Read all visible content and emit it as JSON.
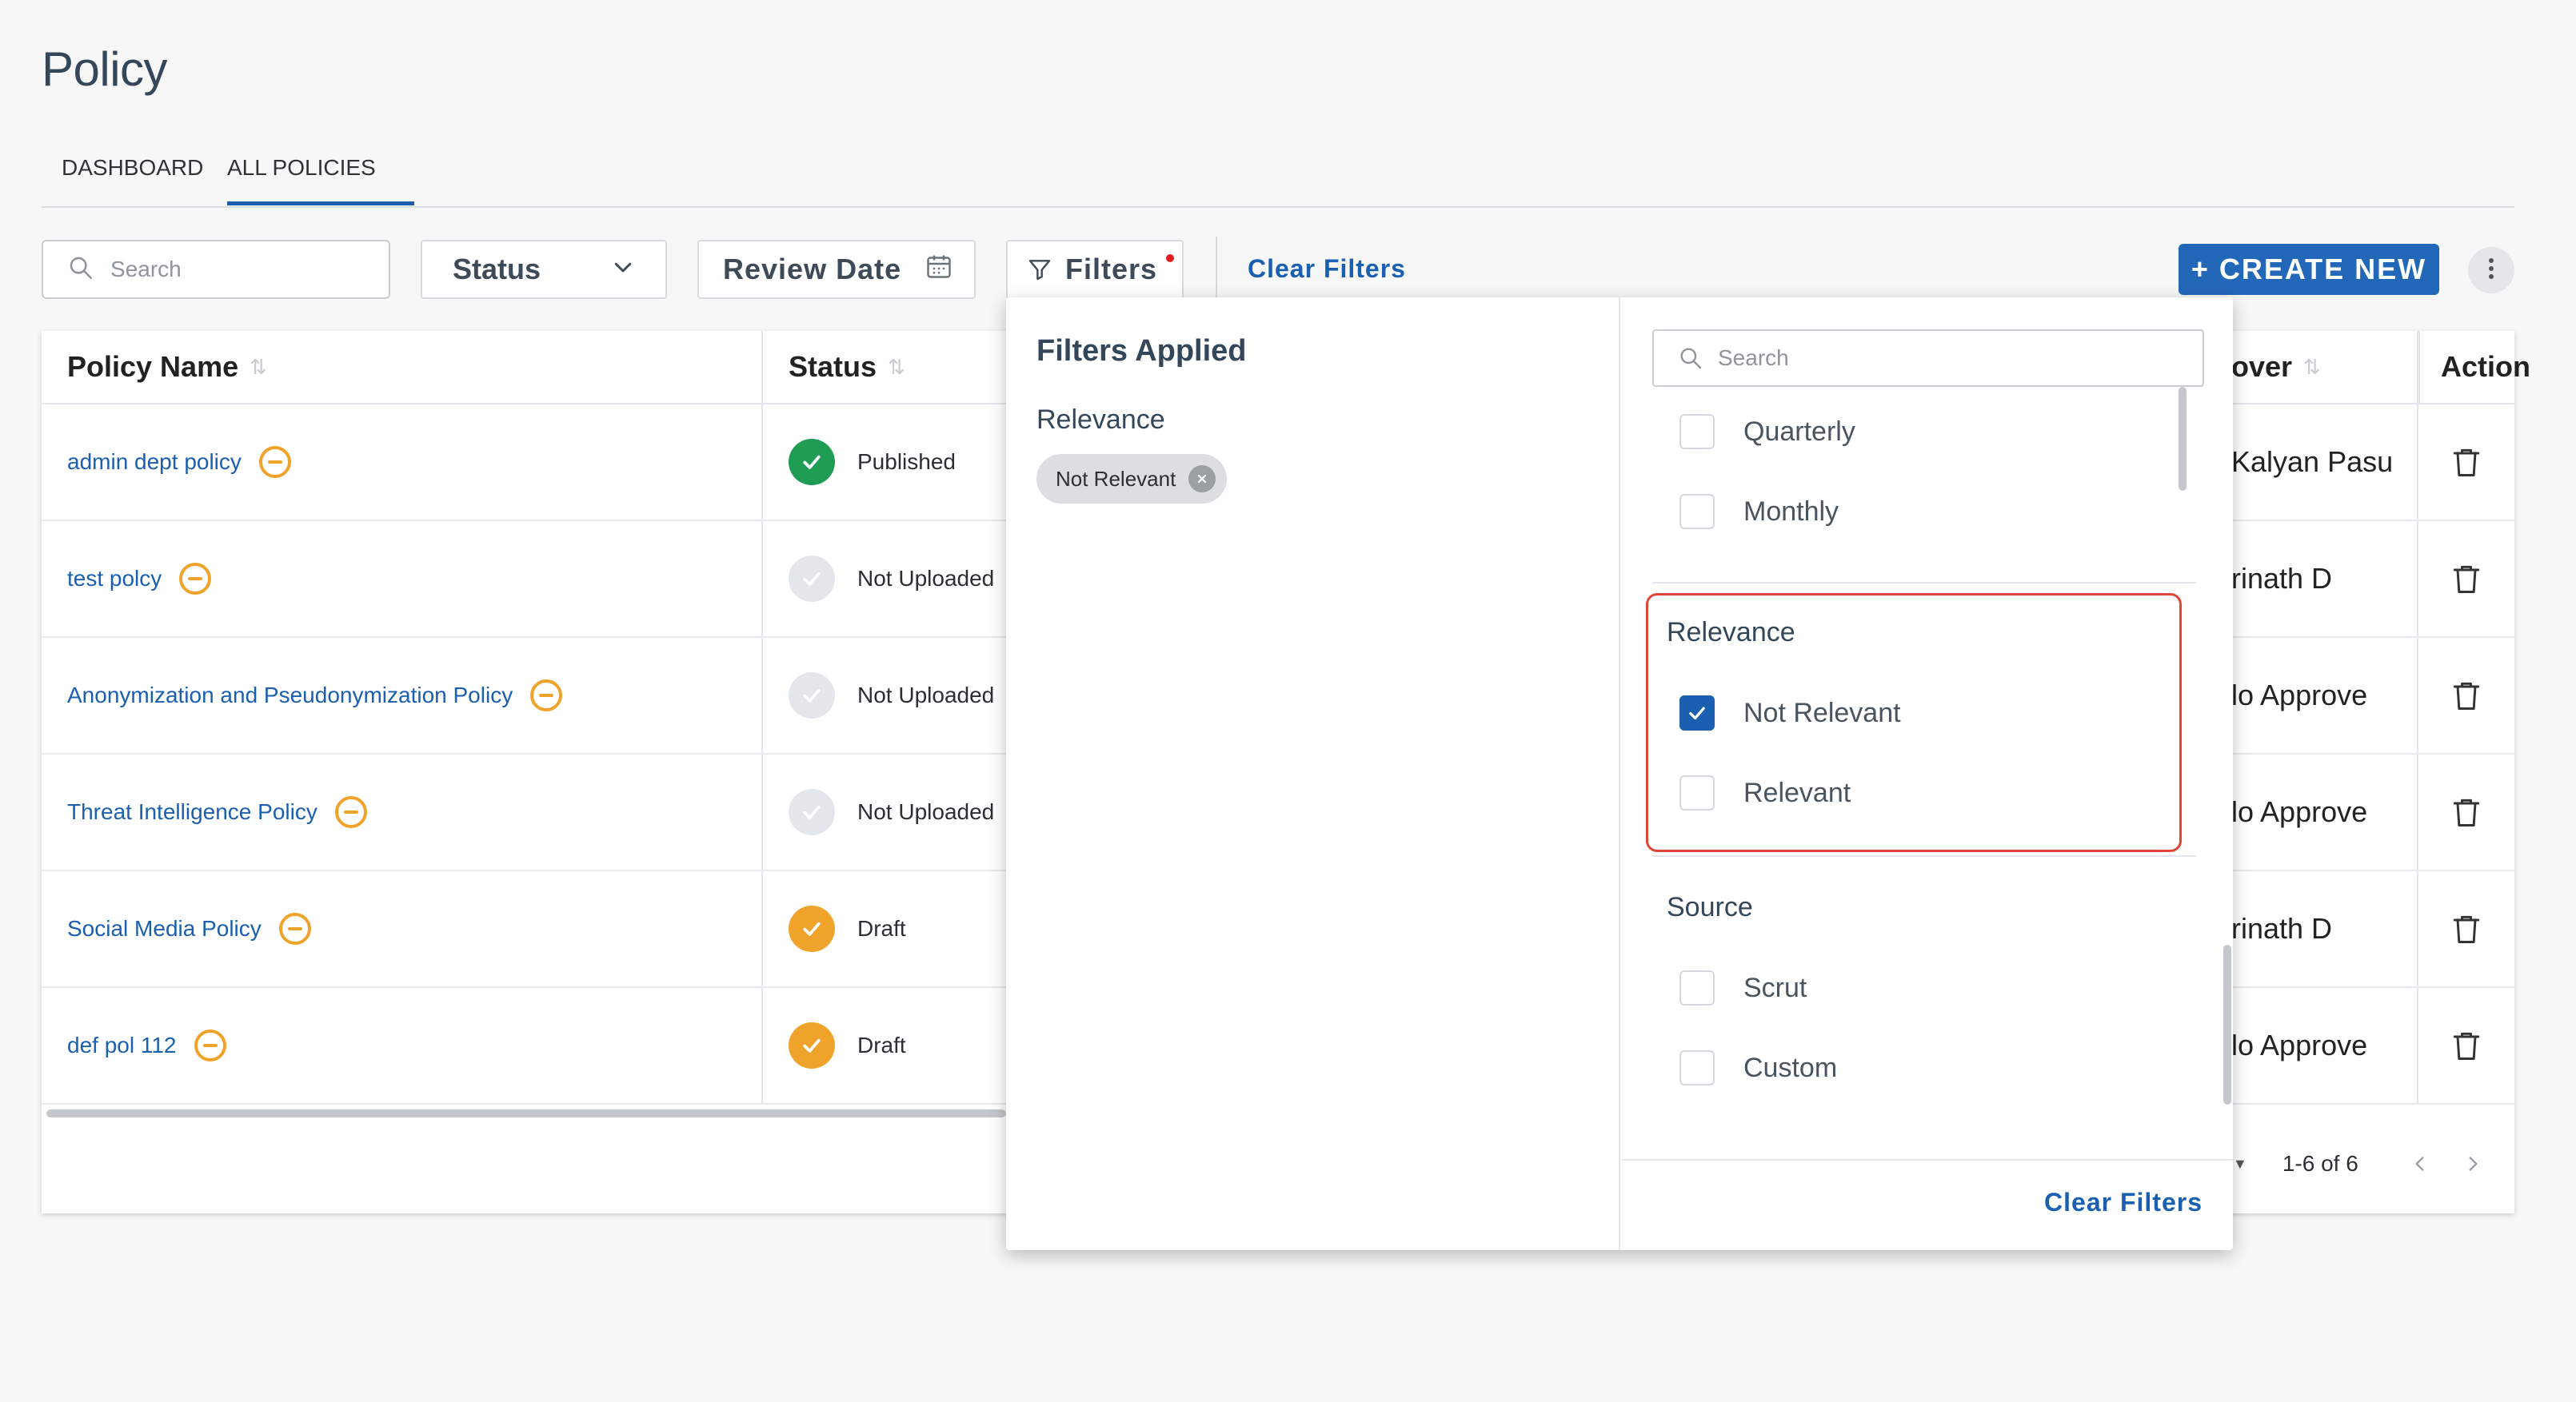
{
  "page": {
    "title": "Policy"
  },
  "tabs": [
    {
      "label": "DASHBOARD"
    },
    {
      "label": "ALL POLICIES",
      "active": true
    }
  ],
  "toolbar": {
    "search_placeholder": "Search",
    "status_label": "Status",
    "review_date_label": "Review Date",
    "filters_label": "Filters",
    "clear_filters_label": "Clear Filters",
    "create_new_label": "+ CREATE NEW"
  },
  "table": {
    "columns": {
      "policy_name": "Policy Name",
      "status": "Status",
      "approver": "over",
      "action": "Action"
    },
    "rows": [
      {
        "name": "admin dept policy",
        "status": "Published",
        "approver": "Kalyan Pasu"
      },
      {
        "name": "test polcy",
        "status": "Not Uploaded",
        "approver": "rinath D"
      },
      {
        "name": "Anonymization and Pseudonymization Policy",
        "status": "Not Uploaded",
        "approver": "lo Approve"
      },
      {
        "name": "Threat Intelligence Policy",
        "status": "Not Uploaded",
        "approver": "lo Approve"
      },
      {
        "name": "Social Media Policy",
        "status": "Draft",
        "approver": "rinath D"
      },
      {
        "name": "def pol 112",
        "status": "Draft",
        "approver": "lo Approve"
      }
    ],
    "pagination": {
      "range": "1-6 of 6"
    }
  },
  "filter_panel": {
    "applied_title": "Filters Applied",
    "applied_group": "Relevance",
    "applied_chip": "Not Relevant",
    "search_placeholder": "Search",
    "frequency_options": [
      "Quarterly",
      "Monthly"
    ],
    "relevance": {
      "label": "Relevance",
      "options": [
        {
          "label": "Not Relevant",
          "checked": true
        },
        {
          "label": "Relevant",
          "checked": false
        }
      ]
    },
    "source": {
      "label": "Source",
      "options": [
        {
          "label": "Scrut",
          "checked": false
        },
        {
          "label": "Custom",
          "checked": false
        }
      ]
    },
    "clear_filters_label": "Clear Filters"
  },
  "colors": {
    "accent": "#1a5fb0",
    "primary_button": "#2367b8",
    "published": "#1f9d55",
    "draft": "#f0a32a",
    "not_uploaded": "#e3e7ec",
    "highlight": "#e0453a"
  }
}
